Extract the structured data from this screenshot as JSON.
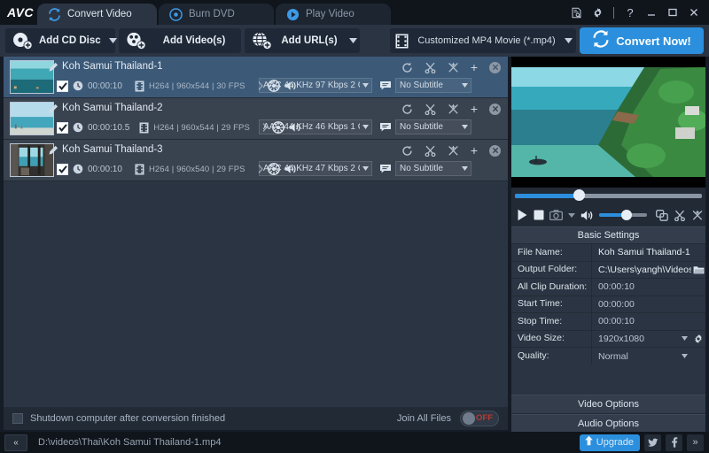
{
  "window": {
    "logo": "AVC",
    "controls": [
      {
        "name": "log-icon",
        "glyph": "log"
      },
      {
        "name": "gear-icon",
        "glyph": "gear"
      },
      {
        "name": "help-icon",
        "glyph": "?"
      },
      {
        "name": "minimize-icon",
        "glyph": "minimize"
      },
      {
        "name": "maximize-icon",
        "glyph": "maximize"
      },
      {
        "name": "close-icon",
        "glyph": "close"
      }
    ]
  },
  "tabs": [
    {
      "label": "Convert Video",
      "icon": "convert-arrows-icon",
      "active": true
    },
    {
      "label": "Burn DVD",
      "icon": "disc-icon",
      "active": false
    },
    {
      "label": "Play Video",
      "icon": "play-circle-icon",
      "active": false
    }
  ],
  "toolbar": {
    "add_cd_disc": "Add CD Disc",
    "add_videos": "Add Video(s)",
    "add_urls": "Add URL(s)",
    "profile": "Customized MP4 Movie (*.mp4)",
    "convert_now": "Convert Now!",
    "accent_color": "#2b8fdd"
  },
  "files": [
    {
      "name": "Koh Samui Thailand-1",
      "duration": "00:00:10",
      "video_info": "H264 | 960x544 | 30 FPS",
      "audio": "AAC 44 KHz 97 Kbps 2 CH ...",
      "subtitle": "No Subtitle",
      "checked": true,
      "selected": true
    },
    {
      "name": "Koh Samui Thailand-2",
      "duration": "00:00:10.5",
      "video_info": "H264 | 960x544 | 29 FPS",
      "audio": "AAC 44 KHz 46 Kbps 1 CH ...",
      "subtitle": "No Subtitle",
      "checked": true,
      "selected": false
    },
    {
      "name": "Koh Samui Thailand-3",
      "duration": "00:00:10",
      "video_info": "H264 | 960x540 | 29 FPS",
      "audio": "AAC 44 KHz 47 Kbps 2 CH ...",
      "subtitle": "No Subtitle",
      "checked": true,
      "selected": false
    }
  ],
  "bottom": {
    "shutdown_label": "Shutdown computer after conversion finished",
    "shutdown_checked": false,
    "join_label": "Join All Files",
    "join_state": "OFF",
    "join_off_color": "#c0392b"
  },
  "player": {
    "play": "play-icon",
    "stop": "stop-icon",
    "snapshot": "camera-icon",
    "volume": "speaker-icon",
    "duplicate": "duplicate-icon",
    "trim": "scissors-icon",
    "effect": "effects-icon"
  },
  "settings": {
    "header": "Basic Settings",
    "rows": [
      {
        "label": "File Name:",
        "value": "Koh Samui Thailand-1",
        "icon": null,
        "bright": true
      },
      {
        "label": "Output Folder:",
        "value": "C:\\Users\\yangh\\Videos...",
        "icon": "folder-icon",
        "bright": true
      },
      {
        "label": "All Clip Duration:",
        "value": "00:00:10",
        "icon": null,
        "bright": false
      },
      {
        "label": "Start Time:",
        "value": "00:00:00",
        "icon": null,
        "bright": false
      },
      {
        "label": "Stop Time:",
        "value": "00:00:10",
        "icon": null,
        "bright": false
      },
      {
        "label": "Video Size:",
        "value": "1920x1080",
        "icon": "caret-gear",
        "bright": false
      },
      {
        "label": "Quality:",
        "value": "Normal",
        "icon": "caret",
        "bright": false
      }
    ],
    "video_options": "Video Options",
    "audio_options": "Audio Options"
  },
  "statusbar": {
    "collapse": "«",
    "path": "D:\\videos\\Thai\\Koh Samui Thailand-1.mp4",
    "upgrade": "Upgrade",
    "social": [
      {
        "name": "twitter-icon"
      },
      {
        "name": "facebook-icon"
      },
      {
        "name": "more-icon",
        "glyph": "»"
      }
    ]
  }
}
